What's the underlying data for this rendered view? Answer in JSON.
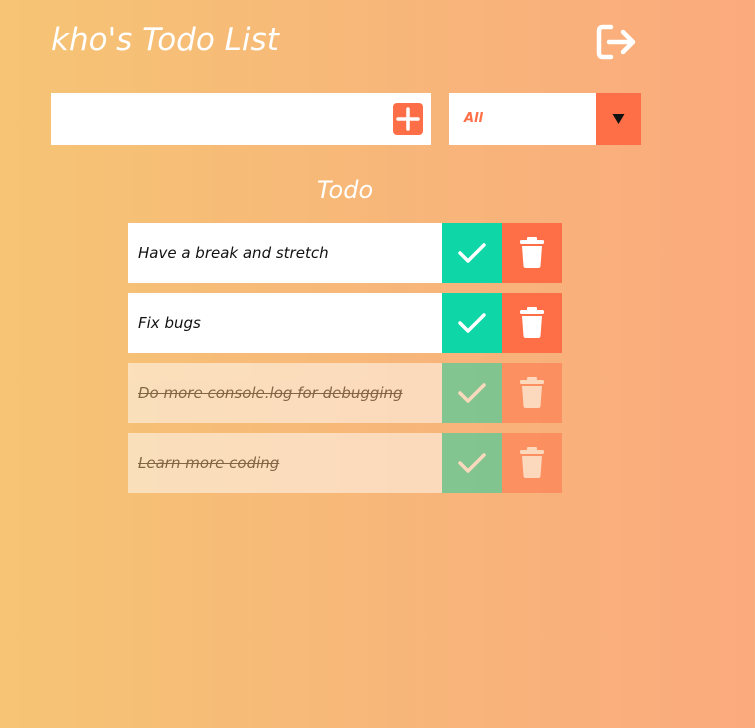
{
  "header": {
    "title": "kho's Todo List",
    "logout_icon": "logout-icon"
  },
  "form": {
    "input_value": "",
    "input_placeholder": "",
    "add_icon": "plus-icon"
  },
  "filter": {
    "selected": "All",
    "arrow_icon": "caret-down-icon"
  },
  "list": {
    "title": "Todo",
    "items": [
      {
        "text": "Have a break and stretch",
        "completed": false
      },
      {
        "text": "Fix bugs",
        "completed": false
      },
      {
        "text": "Do more console.log for debugging",
        "completed": true
      },
      {
        "text": "Learn more coding",
        "completed": true
      }
    ],
    "complete_icon": "check-icon",
    "delete_icon": "trash-icon"
  },
  "colors": {
    "accent": "#ff6f47",
    "complete": "#0fd6a6",
    "gradient_start": "#f6c474",
    "gradient_end": "#fbaa7d"
  }
}
